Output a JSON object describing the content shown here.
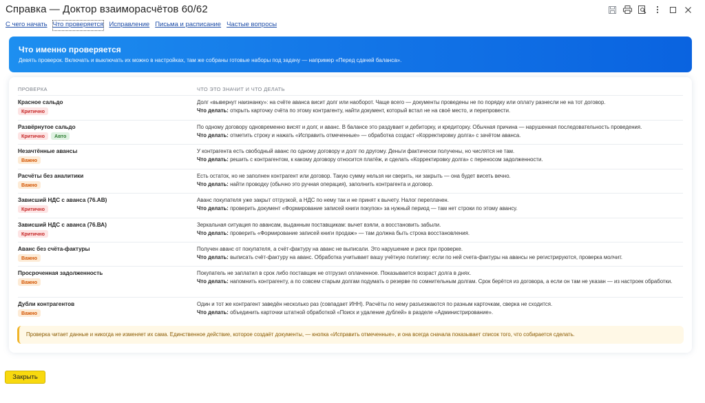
{
  "window": {
    "title": "Справка — Доктор взаиморасчётов 60/62"
  },
  "tabs": [
    {
      "label": "С чего начать"
    },
    {
      "label": "Что проверяется"
    },
    {
      "label": "Исправление"
    },
    {
      "label": "Письма и расписание"
    },
    {
      "label": "Частые вопросы"
    }
  ],
  "active_tab": "Что проверяется",
  "banner": {
    "title": "Что именно проверяется",
    "subtitle": "Девять проверок. Включать и выключать их можно в настройках, там же собраны готовые наборы под задачу — например «Перед сдачей баланса»."
  },
  "table": {
    "headers": {
      "check": "ПРОВЕРКА",
      "meaning": "ЧТО ЭТО ЗНАЧИТ И ЧТО ДЕЛАТЬ"
    },
    "todo_label": "Что делать:",
    "rows": [
      {
        "name": "Красное сальдо",
        "badges": [
          "Критично"
        ],
        "desc": "Долг «вывернут наизнанку»: на счёте аванса висит долг или наоборот. Чаще всего — документы проведены не по порядку или оплату разнесли не на тот договор.",
        "todo": "открыть карточку счёта по этому контрагенту, найти документ, который встал не на своё место, и перепровести."
      },
      {
        "name": "Развёрнутое сальдо",
        "badges": [
          "Критично",
          "Авто"
        ],
        "desc": "По одному договору одновременно висят и долг, и аванс. В балансе это раздувает и дебиторку, и кредиторку. Обычная причина — нарушенная последовательность проведения.",
        "todo": "отметить строку и нажать «Исправить отмеченные» — обработка создаст «Корректировку долга» с зачётом аванса."
      },
      {
        "name": "Незачтённые авансы",
        "badges": [
          "Важно"
        ],
        "desc": "У контрагента есть свободный аванс по одному договору и долг по другому. Деньги фактически получены, но числятся не там.",
        "todo": "решить с контрагентом, к какому договору относится платёж, и сделать «Корректировку долга» с переносом задолженности."
      },
      {
        "name": "Расчёты без аналитики",
        "badges": [
          "Важно"
        ],
        "desc": "Есть остаток, но не заполнен контрагент или договор. Такую сумму нельзя ни сверить, ни закрыть — она будет висеть вечно.",
        "todo": "найти проводку (обычно это ручная операция), заполнить контрагента и договор."
      },
      {
        "name": "Зависший НДС с аванса (76.АВ)",
        "badges": [
          "Критично"
        ],
        "desc": "Аванс покупателя уже закрыт отгрузкой, а НДС по нему так и не принят к вычету. Налог переплачен.",
        "todo": "проверить документ «Формирование записей книги покупок» за нужный период — там нет строки по этому авансу."
      },
      {
        "name": "Зависший НДС с аванса (76.ВА)",
        "badges": [
          "Критично"
        ],
        "desc": "Зеркальная ситуация по авансам, выданным поставщикам: вычет взяли, а восстановить забыли.",
        "todo": "проверить «Формирование записей книги продаж» — там должна быть строка восстановления."
      },
      {
        "name": "Аванс без счёта-фактуры",
        "badges": [
          "Важно"
        ],
        "desc": "Получен аванс от покупателя, а счёт-фактуру на аванс не выписали. Это нарушение и риск при проверке.",
        "todo": "выписать счёт-фактуру на аванс. Обработка учитывает вашу учётную политику: если по ней счета-фактуры на авансы не регистрируются, проверка молчит."
      },
      {
        "name": "Просроченная задолженность",
        "badges": [
          "Важно"
        ],
        "desc": "Покупатель не заплатил в срок либо поставщик не отгрузил оплаченное. Показывается возраст долга в днях.",
        "todo": "напомнить контрагенту, а по совсем старым долгам подумать о резерве по сомнительным долгам. Срок берётся из договора, а если он там не указан — из настроек обработки."
      },
      {
        "name": "Дубли контрагентов",
        "badges": [
          "Важно"
        ],
        "desc": "Один и тот же контрагент заведён несколько раз (совпадает ИНН). Расчёты по нему разъезжаются по разным карточкам, сверка не сходится.",
        "todo": "объединить карточки штатной обработкой «Поиск и удаление дублей» в разделе «Администрирование»."
      }
    ]
  },
  "note": "Проверка читает данные и никогда не изменяет их сама. Единственное действие, которое создаёт документы, — кнопка «Исправить отмеченные», и она всегда сначала показывает список того, что собирается сделать.",
  "footer": {
    "close_label": "Закрыть"
  },
  "colors": {
    "accent": "#1478e8",
    "critical": "#c62828",
    "important": "#d35400",
    "auto": "#2e7d32",
    "close_button": "#f8d90f"
  },
  "icons": [
    "save-icon",
    "print-icon",
    "preview-icon",
    "more-icon",
    "maximize-icon",
    "close-icon"
  ]
}
